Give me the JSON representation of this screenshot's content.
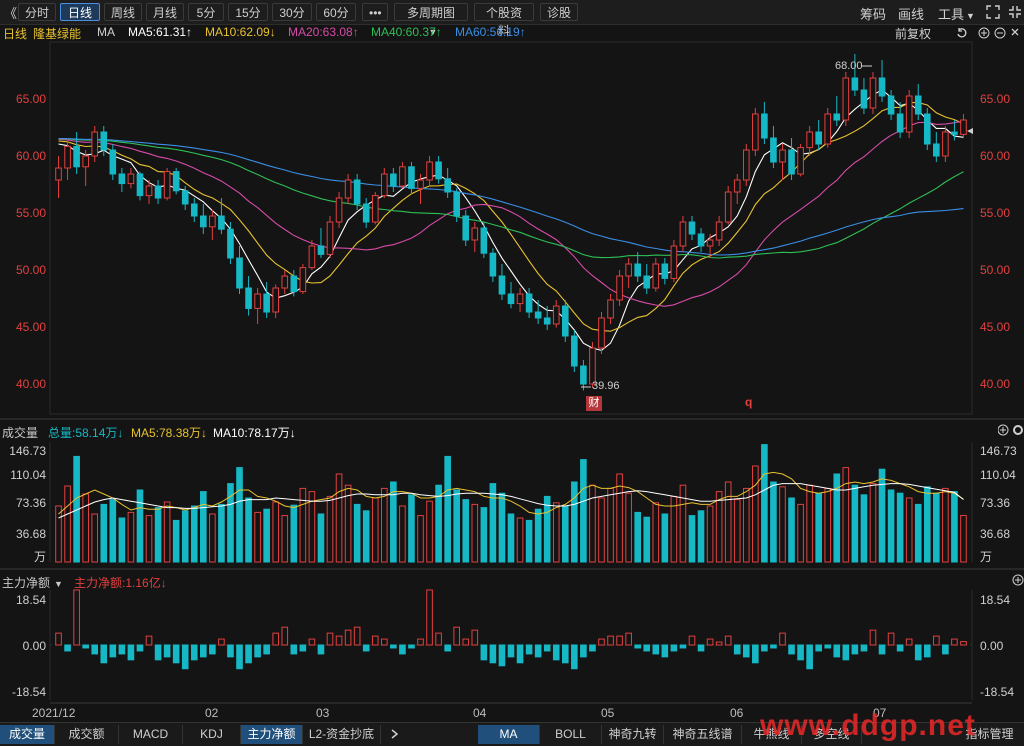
{
  "toolbar": {
    "left_arrow": "《",
    "tabs": [
      "分时",
      "日线",
      "周线",
      "月线",
      "5分",
      "15分",
      "30分",
      "60分",
      "•••",
      "多周期图",
      "个股资料",
      "诊股"
    ],
    "active_tab": "日线",
    "dropdown_caret": "▼",
    "right": [
      "筹码",
      "画线",
      "工具"
    ],
    "tool_caret": "▼"
  },
  "ma_line": {
    "period": "日线",
    "stock_name": "隆基绿能",
    "ma_label": "MA",
    "ma5": "MA5:61.31↑",
    "ma10": "MA10:62.09↓",
    "ma20": "MA20:63.08↑",
    "ma40": "MA40:60.37↑",
    "ma60": "MA60:56.19↑",
    "restore": "前复权"
  },
  "price_axis": {
    "ticks": [
      "65.00",
      "60.00",
      "55.00",
      "50.00",
      "45.00",
      "40.00"
    ],
    "high_label": "68.00",
    "low_label": "39.96",
    "badge_cai": "财",
    "badge_q": "q"
  },
  "volume_panel": {
    "title": "成交量",
    "total": "总量:58.14万↓",
    "ma5": "MA5:78.38万↓",
    "ma10": "MA10:78.17万↓",
    "ticks": [
      "146.73",
      "110.04",
      "73.36",
      "36.68"
    ],
    "unit": "万"
  },
  "flow_panel": {
    "title": "主力净额",
    "caret": "▼",
    "value": "主力净额:1.16亿↓",
    "ticks": [
      "18.54",
      "0.00",
      "-18.54"
    ]
  },
  "x_axis": {
    "labels": [
      "2021/12",
      "02",
      "03",
      "04",
      "05",
      "06",
      "07"
    ]
  },
  "bottom_tabs": {
    "left": [
      "成交量",
      "成交额",
      "MACD",
      "KDJ",
      "主力净额",
      "L2-资金抄底"
    ],
    "right": [
      "MA",
      "BOLL",
      "神奇九转",
      "神奇五线谱",
      "牛熊线",
      "多空线"
    ],
    "right_last": "指标管理",
    "watermark": "www.ddgp.net"
  },
  "colors": {
    "up": "#e2403f",
    "down": "#16b8c6",
    "ma5": "#ffffff",
    "ma10": "#e9c230",
    "ma20": "#d64ba8",
    "ma40": "#2fbf56",
    "ma60": "#3a8ee6"
  },
  "chart_data": {
    "type": "candlestick",
    "price_ylim": [
      38,
      69
    ],
    "volume_ylim": [
      0,
      150
    ],
    "flow_ylim": [
      -18.54,
      18.54
    ],
    "ohlc": [
      [
        57.5,
        59.5,
        56.0,
        58.5
      ],
      [
        58.5,
        61.0,
        57.5,
        60.3
      ],
      [
        60.3,
        61.5,
        58.0,
        58.6
      ],
      [
        58.6,
        60.0,
        57.0,
        59.5
      ],
      [
        59.5,
        62.0,
        59.0,
        61.5
      ],
      [
        61.5,
        62.0,
        59.5,
        60.0
      ],
      [
        60.0,
        60.5,
        57.5,
        58.0
      ],
      [
        58.0,
        58.5,
        56.5,
        57.2
      ],
      [
        57.2,
        58.5,
        56.8,
        58.0
      ],
      [
        58.0,
        58.2,
        55.8,
        56.2
      ],
      [
        56.2,
        57.5,
        55.5,
        57.0
      ],
      [
        57.0,
        57.5,
        55.5,
        56.0
      ],
      [
        56.0,
        58.5,
        55.8,
        58.2
      ],
      [
        58.2,
        58.5,
        56.3,
        56.6
      ],
      [
        56.6,
        57.0,
        55.0,
        55.5
      ],
      [
        55.5,
        56.0,
        54.0,
        54.5
      ],
      [
        54.5,
        55.5,
        53.0,
        53.6
      ],
      [
        53.6,
        55.0,
        52.5,
        54.5
      ],
      [
        54.5,
        56.0,
        53.0,
        53.4
      ],
      [
        53.4,
        54.0,
        50.5,
        51.0
      ],
      [
        51.0,
        52.0,
        48.0,
        48.5
      ],
      [
        48.5,
        49.5,
        46.2,
        46.8
      ],
      [
        46.8,
        48.5,
        45.5,
        48.0
      ],
      [
        48.0,
        49.0,
        46.0,
        46.5
      ],
      [
        46.5,
        48.8,
        46.0,
        48.5
      ],
      [
        48.5,
        50.0,
        48.0,
        49.5
      ],
      [
        49.5,
        50.0,
        47.8,
        48.2
      ],
      [
        48.2,
        50.5,
        48.0,
        50.2
      ],
      [
        50.2,
        52.5,
        50.0,
        52.0
      ],
      [
        52.0,
        53.5,
        51.0,
        51.3
      ],
      [
        51.3,
        54.5,
        51.0,
        54.0
      ],
      [
        54.0,
        56.5,
        53.5,
        56.0
      ],
      [
        56.0,
        58.0,
        55.5,
        57.5
      ],
      [
        57.5,
        58.0,
        55.0,
        55.5
      ],
      [
        55.5,
        56.0,
        53.5,
        54.0
      ],
      [
        54.0,
        56.5,
        53.8,
        56.2
      ],
      [
        56.2,
        58.5,
        56.0,
        58.0
      ],
      [
        58.0,
        58.5,
        56.5,
        57.0
      ],
      [
        57.0,
        59.0,
        56.8,
        58.6
      ],
      [
        58.6,
        59.0,
        56.3,
        56.8
      ],
      [
        56.8,
        58.0,
        55.5,
        57.5
      ],
      [
        57.5,
        59.5,
        57.0,
        59.0
      ],
      [
        59.0,
        59.5,
        57.2,
        57.6
      ],
      [
        57.6,
        58.5,
        56.0,
        56.5
      ],
      [
        56.5,
        56.8,
        54.0,
        54.5
      ],
      [
        54.5,
        55.0,
        52.0,
        52.5
      ],
      [
        52.5,
        54.0,
        51.5,
        53.5
      ],
      [
        53.5,
        54.0,
        51.0,
        51.4
      ],
      [
        51.4,
        51.8,
        49.0,
        49.5
      ],
      [
        49.5,
        50.5,
        47.5,
        48.0
      ],
      [
        48.0,
        49.0,
        46.8,
        47.2
      ],
      [
        47.2,
        48.5,
        46.5,
        48.0
      ],
      [
        48.0,
        48.5,
        46.0,
        46.5
      ],
      [
        46.5,
        47.5,
        45.5,
        46.0
      ],
      [
        46.0,
        47.0,
        45.0,
        45.5
      ],
      [
        45.5,
        47.5,
        45.2,
        47.0
      ],
      [
        47.0,
        47.5,
        44.0,
        44.5
      ],
      [
        44.5,
        45.0,
        41.5,
        42.0
      ],
      [
        42.0,
        42.5,
        39.96,
        40.5
      ],
      [
        40.5,
        44.0,
        40.2,
        43.5
      ],
      [
        43.5,
        46.5,
        43.0,
        46.0
      ],
      [
        46.0,
        48.0,
        45.5,
        47.5
      ],
      [
        47.5,
        50.0,
        47.0,
        49.5
      ],
      [
        49.5,
        51.0,
        48.5,
        50.5
      ],
      [
        50.5,
        51.5,
        49.0,
        49.5
      ],
      [
        49.5,
        50.5,
        48.0,
        48.5
      ],
      [
        48.5,
        51.0,
        48.2,
        50.5
      ],
      [
        50.5,
        51.0,
        48.8,
        49.3
      ],
      [
        49.3,
        52.5,
        49.0,
        52.0
      ],
      [
        52.0,
        54.5,
        51.5,
        54.0
      ],
      [
        54.0,
        54.5,
        52.5,
        53.0
      ],
      [
        53.0,
        53.5,
        51.5,
        52.0
      ],
      [
        52.0,
        53.0,
        51.0,
        52.5
      ],
      [
        52.5,
        54.5,
        52.0,
        54.0
      ],
      [
        54.0,
        57.0,
        53.8,
        56.5
      ],
      [
        56.5,
        58.0,
        55.5,
        57.5
      ],
      [
        57.5,
        60.5,
        57.0,
        60.0
      ],
      [
        60.0,
        63.5,
        59.5,
        63.0
      ],
      [
        63.0,
        64.0,
        60.5,
        61.0
      ],
      [
        61.0,
        62.0,
        58.5,
        59.0
      ],
      [
        59.0,
        60.5,
        57.5,
        60.0
      ],
      [
        60.0,
        61.0,
        57.5,
        58.0
      ],
      [
        58.0,
        60.5,
        57.8,
        60.2
      ],
      [
        60.2,
        62.0,
        59.5,
        61.5
      ],
      [
        61.5,
        62.5,
        60.0,
        60.5
      ],
      [
        60.5,
        63.5,
        60.2,
        63.0
      ],
      [
        63.0,
        64.5,
        62.0,
        62.5
      ],
      [
        62.5,
        66.5,
        62.0,
        66.0
      ],
      [
        66.0,
        68.0,
        64.5,
        65.0
      ],
      [
        65.0,
        66.0,
        63.0,
        63.5
      ],
      [
        63.5,
        66.5,
        63.0,
        66.0
      ],
      [
        66.0,
        67.5,
        64.0,
        64.5
      ],
      [
        64.5,
        65.0,
        62.5,
        63.0
      ],
      [
        63.0,
        64.0,
        61.0,
        61.5
      ],
      [
        61.5,
        65.0,
        61.0,
        64.5
      ],
      [
        64.5,
        65.5,
        62.5,
        63.0
      ],
      [
        63.0,
        63.5,
        60.0,
        60.5
      ],
      [
        60.5,
        61.5,
        59.0,
        59.5
      ],
      [
        59.5,
        62.0,
        59.0,
        61.5
      ],
      [
        61.5,
        62.5,
        60.8,
        61.3
      ],
      [
        61.3,
        63.0,
        61.0,
        62.5
      ]
    ],
    "volume": [
      70,
      95,
      132,
      85,
      60,
      72,
      78,
      55,
      62,
      90,
      58,
      68,
      75,
      52,
      64,
      70,
      88,
      60,
      72,
      98,
      118,
      80,
      62,
      66,
      75,
      58,
      71,
      92,
      88,
      60,
      82,
      110,
      96,
      72,
      64,
      80,
      92,
      100,
      70,
      84,
      58,
      76,
      96,
      132,
      90,
      78,
      72,
      68,
      98,
      86,
      60,
      55,
      52,
      66,
      82,
      74,
      70,
      100,
      128,
      96,
      80,
      92,
      110,
      86,
      62,
      56,
      74,
      60,
      82,
      96,
      58,
      64,
      70,
      88,
      100,
      78,
      92,
      120,
      146.73,
      100,
      94,
      80,
      72,
      96,
      86,
      92,
      110,
      118,
      96,
      84,
      98,
      116,
      90,
      86,
      80,
      72,
      94,
      86,
      92,
      88,
      58.14
    ],
    "ma5_vol": [
      60,
      70,
      80,
      85,
      90,
      85,
      80,
      72,
      65,
      68,
      66,
      66,
      70,
      68,
      65,
      68,
      72,
      70,
      75,
      82,
      90,
      90,
      82,
      80,
      76,
      70,
      68,
      72,
      76,
      78,
      80,
      88,
      92,
      90,
      82,
      80,
      82,
      88,
      88,
      86,
      80,
      80,
      82,
      90,
      92,
      90,
      88,
      82,
      80,
      80,
      76,
      70,
      62,
      60,
      62,
      68,
      72,
      80,
      92,
      96,
      92,
      92,
      95,
      93,
      88,
      80,
      72,
      70,
      70,
      72,
      74,
      72,
      72,
      78,
      82,
      82,
      88,
      96,
      110,
      112,
      110,
      104,
      92,
      88,
      86,
      88,
      92,
      98,
      100,
      98,
      100,
      104,
      102,
      98,
      94,
      88,
      86,
      86,
      88,
      86,
      78.38
    ],
    "ma10_vol": [
      55,
      60,
      65,
      70,
      75,
      78,
      80,
      78,
      76,
      74,
      72,
      70,
      68,
      68,
      67,
      67,
      68,
      69,
      70,
      72,
      76,
      78,
      78,
      78,
      80,
      79,
      78,
      77,
      76,
      76,
      77,
      80,
      83,
      85,
      85,
      84,
      84,
      84,
      86,
      86,
      84,
      83,
      82,
      83,
      85,
      86,
      86,
      86,
      85,
      84,
      82,
      79,
      76,
      73,
      71,
      70,
      70,
      72,
      76,
      80,
      82,
      84,
      86,
      88,
      89,
      88,
      86,
      84,
      82,
      80,
      78,
      76,
      76,
      77,
      78,
      79,
      80,
      84,
      90,
      96,
      98,
      98,
      98,
      96,
      94,
      92,
      90,
      90,
      92,
      94,
      96,
      97,
      98,
      98,
      97,
      95,
      93,
      91,
      89,
      87,
      78.17
    ],
    "main_net": [
      4,
      -2,
      18.54,
      -1,
      -3,
      -6,
      -4,
      -3,
      -5,
      -2,
      3,
      -5,
      -4,
      -6,
      -8,
      -5,
      -4,
      -3,
      2,
      -4,
      -8,
      -6,
      -4,
      -3,
      4,
      6,
      -3,
      -2,
      2,
      -3,
      4,
      3,
      5,
      6,
      -2,
      3,
      2,
      -1,
      -3,
      -1,
      2,
      18.54,
      4,
      -2,
      6,
      2,
      5,
      -5,
      -6,
      -7,
      -4,
      -6,
      -3,
      -4,
      -2,
      -5,
      -6,
      -8,
      -4,
      -2,
      2,
      3,
      3,
      4,
      -1,
      -2,
      -3,
      -4,
      -2,
      -1,
      3,
      -2,
      2,
      1,
      3,
      -3,
      -4,
      -6,
      -2,
      -1,
      4,
      -3,
      -5,
      -8,
      -2,
      -1,
      -4,
      -5,
      -3,
      -2,
      5,
      -3,
      4,
      -2,
      2,
      -5,
      -4,
      3,
      -3,
      2,
      1.16
    ]
  }
}
